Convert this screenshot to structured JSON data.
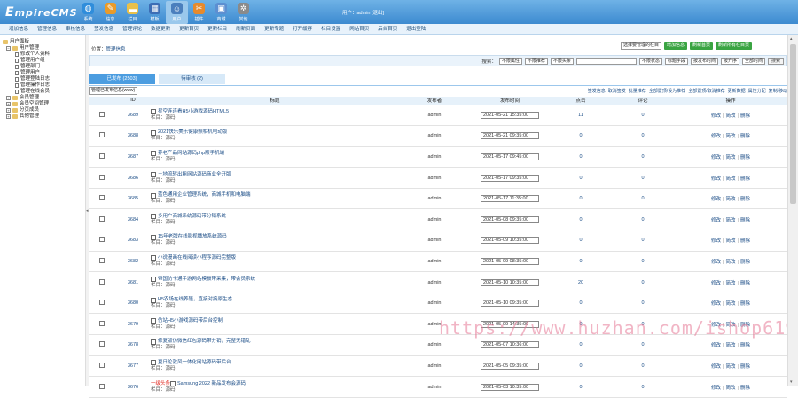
{
  "app": {
    "logo_small": "E",
    "logo_rest": "mpireCMS"
  },
  "topnav": [
    {
      "label": "系统",
      "icon": "globe-icon",
      "color": "#2f8ddb"
    },
    {
      "label": "信息",
      "icon": "pencil-icon",
      "color": "#e99b2a"
    },
    {
      "label": "栏目",
      "icon": "folder-icon",
      "color": "#e9c04a"
    },
    {
      "label": "模板",
      "icon": "template-icon",
      "color": "#3c6db5"
    },
    {
      "label": "用户",
      "icon": "user-icon",
      "color": "#4a7fbd",
      "active": true
    },
    {
      "label": "插件",
      "icon": "tools-icon",
      "color": "#e78a2c"
    },
    {
      "label": "商城",
      "icon": "shop-icon",
      "color": "#5c8fd1"
    },
    {
      "label": "其他",
      "icon": "gear-icon",
      "color": "#8a8a8a"
    }
  ],
  "userinfo": "用户：admin  [退出]",
  "subnav": [
    "增加信息",
    "管理信息",
    "审核信息",
    "签发信息",
    "管理评论",
    "数据更新",
    "更新首页",
    "更新栏目",
    "刷新页面",
    "更新专题",
    "打开缓存",
    "栏目设置",
    "网站首页",
    "后台首页",
    "退出登陆"
  ],
  "tree": [
    {
      "label": "用户面板",
      "type": "root"
    },
    {
      "label": "用户管理",
      "type": "folder",
      "open": true
    },
    {
      "label": "修改个人资料",
      "type": "doc"
    },
    {
      "label": "管理用户组",
      "type": "doc"
    },
    {
      "label": "管理部门",
      "type": "doc"
    },
    {
      "label": "管理用户",
      "type": "doc"
    },
    {
      "label": "管理登陆日志",
      "type": "doc"
    },
    {
      "label": "管理操作日志",
      "type": "doc"
    },
    {
      "label": "管理在线会员",
      "type": "doc"
    },
    {
      "label": "会员管理",
      "type": "folder"
    },
    {
      "label": "会员空间管理",
      "type": "folder"
    },
    {
      "label": "分页成员",
      "type": "folder"
    },
    {
      "label": "其他管理",
      "type": "folder"
    }
  ],
  "location": {
    "prefix": "位置：",
    "link": "管理信息"
  },
  "topbtns": {
    "select": "选择要管理的栏目",
    "btn1": "增加信息",
    "btn2": "刷新首页",
    "btn3": "刷新所有栏目页"
  },
  "search": {
    "label": "搜索：",
    "selects": [
      "不限属性",
      "不限推荐",
      "不限头条"
    ],
    "input_value": "",
    "selects2": [
      "不限状态",
      "标题字段",
      "按发布时间",
      "按升序",
      "全部时间"
    ],
    "button": "搜索"
  },
  "tabs": [
    {
      "label": "已发布 (2503)"
    },
    {
      "label": "待审核 (2)"
    }
  ],
  "toolrow": {
    "select": "管理已发布信息(www)",
    "links": [
      "签发信息",
      "取消签发",
      "批量推荐",
      "全部置顶/设为推荐",
      "全部置顶/取消推荐",
      "更新数据",
      "属性分配",
      "复制/移动"
    ]
  },
  "table": {
    "headers": [
      "",
      "ID",
      "标题",
      "发布者",
      "发布时间",
      "点击",
      "评论",
      "操作"
    ],
    "rows": [
      {
        "id": "3689",
        "title": "星空连连看H5小游戏源码HTML5",
        "column": "栏目：源码",
        "author": "admin",
        "time": "2021-05-21 15:35:00",
        "clicks": "11",
        "comments": "0",
        "new_badge": ""
      },
      {
        "id": "3688",
        "title": "2021快乐美乐健康照相机电动版",
        "column": "栏目：源码",
        "author": "admin",
        "time": "2021-05-21 09:35:00",
        "clicks": "0",
        "comments": "0",
        "new_badge": ""
      },
      {
        "id": "3687",
        "title": "养老产品网站源码php版手机端",
        "column": "栏目：源码",
        "author": "admin",
        "time": "2021-05-17 09:45:00",
        "clicks": "0",
        "comments": "0",
        "new_badge": ""
      },
      {
        "id": "3686",
        "title": "土地流转出租网站源码商业全开版",
        "column": "栏目：源码",
        "author": "admin",
        "time": "2021-05-17 09:35:00",
        "clicks": "0",
        "comments": "0",
        "new_badge": ""
      },
      {
        "id": "3685",
        "title": "蓝色通用企业管理系统，商城手机和电脑端",
        "column": "栏目：源码",
        "author": "admin",
        "time": "2021-05-17 11:35:00",
        "clicks": "0",
        "comments": "0",
        "new_badge": ""
      },
      {
        "id": "3684",
        "title": "多用户商城系统源码带分销系统",
        "column": "栏目：源码",
        "author": "admin",
        "time": "2021-05-08 09:35:00",
        "clicks": "0",
        "comments": "0",
        "new_badge": ""
      },
      {
        "id": "3683",
        "title": "15年老牌在线影视播放系统源码",
        "column": "栏目：源码",
        "author": "admin",
        "time": "2021-05-09 10:35:00",
        "clicks": "0",
        "comments": "0",
        "new_badge": ""
      },
      {
        "id": "3682",
        "title": "小说漫画在线阅读小程序源码完整版",
        "column": "栏目：源码",
        "author": "admin",
        "time": "2021-05-09 08:35:00",
        "clicks": "0",
        "comments": "0",
        "new_badge": ""
      },
      {
        "id": "3681",
        "title": "帝国仿卡通手游网站模板带采集，带会员系统",
        "column": "栏目：源码",
        "author": "admin",
        "time": "2021-05-10 10:35:00",
        "clicks": "20",
        "comments": "0",
        "new_badge": ""
      },
      {
        "id": "3680",
        "title": "H5农场在线养殖，直接对接原生态",
        "column": "栏目：源码",
        "author": "admin",
        "time": "2021-05-10 09:35:00",
        "clicks": "0",
        "comments": "0",
        "new_badge": ""
      },
      {
        "id": "3679",
        "title": "仿站H5小游戏源码带后台控制",
        "column": "栏目：源码",
        "author": "admin",
        "time": "2021-05-09 14:35:00",
        "clicks": "0",
        "comments": "0",
        "new_badge": ""
      },
      {
        "id": "3678",
        "title": "修复版仿微信红包源码带分销，完整无错乱",
        "column": "栏目：源码",
        "author": "admin",
        "time": "2021-05-07 10:36:00",
        "clicks": "0",
        "comments": "0",
        "new_badge": ""
      },
      {
        "id": "3677",
        "title": "夏日伦敦风一体化网站源码带后台",
        "column": "栏目：源码",
        "author": "admin",
        "time": "2021-05-05 09:35:00",
        "clicks": "0",
        "comments": "0",
        "new_badge": ""
      },
      {
        "id": "3676",
        "title": "Samsung 2022 新品发布会源码",
        "column": "栏目：源码",
        "author": "admin",
        "time": "2021-05-03 10:35:00",
        "clicks": "0",
        "comments": "0",
        "new_badge": "一级头条"
      }
    ],
    "ops": [
      "修改",
      "简改",
      "删除"
    ]
  },
  "watermark": "https://www.huzhan.com/ishop6196"
}
